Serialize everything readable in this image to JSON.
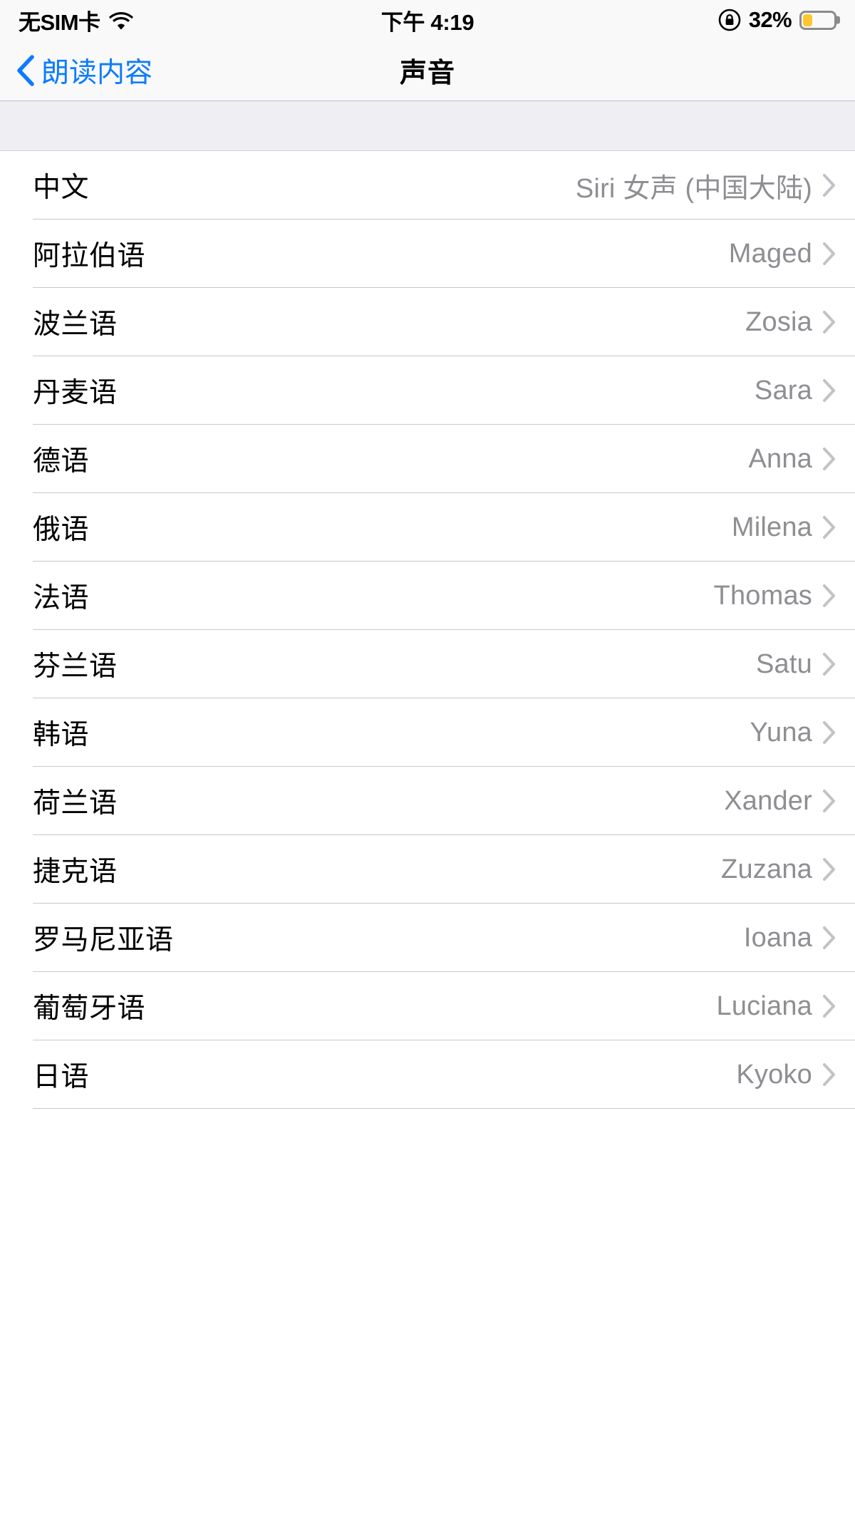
{
  "status_bar": {
    "carrier": "无SIM卡",
    "wifi_icon": "wifi-icon",
    "time": "下午 4:19",
    "rotation_lock_icon": "rotation-lock-icon",
    "battery_percent": "32%",
    "battery_level": 32,
    "battery_color": "#fdc62e"
  },
  "nav_bar": {
    "back_icon": "chevron-left-icon",
    "back_label": "朗读内容",
    "title": "声音"
  },
  "colors": {
    "tint": "#0b7bff",
    "bar_background": "#f9f9f9",
    "group_header_background": "#eeeef3",
    "separator": "#c8c7cc",
    "value_text": "#8e8e93"
  },
  "section": {
    "header_text": "",
    "rows": [
      {
        "label": "中文",
        "value": "Siri 女声 (中国大陆)",
        "accessory": "chevron-right-icon"
      },
      {
        "label": "阿拉伯语",
        "value": "Maged",
        "accessory": "chevron-right-icon"
      },
      {
        "label": "波兰语",
        "value": "Zosia",
        "accessory": "chevron-right-icon"
      },
      {
        "label": "丹麦语",
        "value": "Sara",
        "accessory": "chevron-right-icon"
      },
      {
        "label": "德语",
        "value": "Anna",
        "accessory": "chevron-right-icon"
      },
      {
        "label": "俄语",
        "value": "Milena",
        "accessory": "chevron-right-icon"
      },
      {
        "label": "法语",
        "value": "Thomas",
        "accessory": "chevron-right-icon"
      },
      {
        "label": "芬兰语",
        "value": "Satu",
        "accessory": "chevron-right-icon"
      },
      {
        "label": "韩语",
        "value": "Yuna",
        "accessory": "chevron-right-icon"
      },
      {
        "label": "荷兰语",
        "value": "Xander",
        "accessory": "chevron-right-icon"
      },
      {
        "label": "捷克语",
        "value": "Zuzana",
        "accessory": "chevron-right-icon"
      },
      {
        "label": "罗马尼亚语",
        "value": "Ioana",
        "accessory": "chevron-right-icon"
      },
      {
        "label": "葡萄牙语",
        "value": "Luciana",
        "accessory": "chevron-right-icon"
      },
      {
        "label": "日语",
        "value": "Kyoko",
        "accessory": "chevron-right-icon"
      }
    ]
  }
}
